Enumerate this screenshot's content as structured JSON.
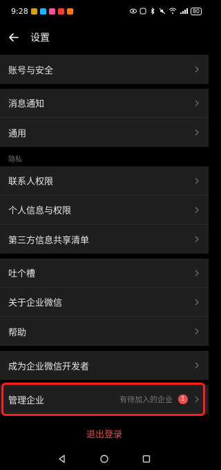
{
  "status_bar": {
    "time": "9:28",
    "battery": "80",
    "colors": {
      "app1": "#d6a100",
      "app2": "#19b4ff",
      "app3": "#ff4fa1",
      "app4": "#ff3b30",
      "app5": "#ff7a00"
    }
  },
  "header": {
    "title": "设置",
    "back_icon": "arrow-left-icon"
  },
  "groups": {
    "account": {
      "items": [
        {
          "label": "账号与安全"
        }
      ]
    },
    "general": {
      "items": [
        {
          "label": "消息通知"
        },
        {
          "label": "通用"
        }
      ]
    },
    "privacy": {
      "section_label": "隐私",
      "items": [
        {
          "label": "联系人权限"
        },
        {
          "label": "个人信息与权限"
        },
        {
          "label": "第三方信息共享清单"
        }
      ]
    },
    "feedback": {
      "items": [
        {
          "label": "吐个槽"
        },
        {
          "label": "关于企业微信"
        },
        {
          "label": "帮助"
        }
      ]
    },
    "developer": {
      "items": [
        {
          "label": "成为企业微信开发者"
        }
      ]
    },
    "manage": {
      "items": [
        {
          "label": "管理企业",
          "hint": "有待加入的企业",
          "badge": "1"
        }
      ]
    }
  },
  "logout": {
    "label": "退出登录"
  },
  "nav": {
    "back": "back-triangle-icon",
    "home": "home-circle-icon",
    "recents": "recents-square-icon"
  },
  "colors": {
    "background": "#000000",
    "group_bg": "#1f1f1f",
    "danger": "#e24b4b",
    "badge": "#ef4d4d",
    "highlight": "#ff1e1e"
  }
}
